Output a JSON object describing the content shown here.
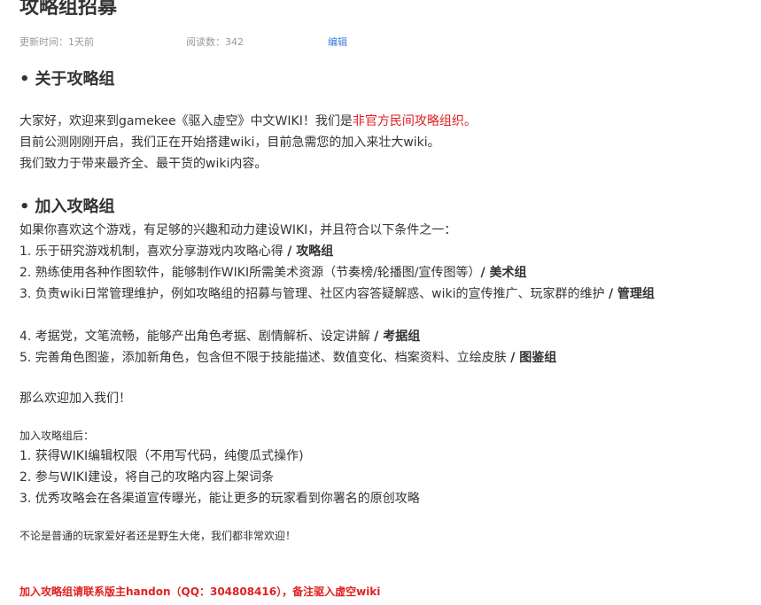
{
  "article": {
    "title": "攻略组招募",
    "meta": {
      "updated": "更新时间：1天前",
      "reads": "阅读数：342",
      "edit": "编辑"
    }
  },
  "sections": {
    "about": {
      "heading": "关于攻略组",
      "line1_part1": "大家好，欢迎来到gamekee《驱入虚空》中文WIKI！",
      "line1_part2": "我们是",
      "line1_red": "非官方民间攻略组织。",
      "line2": "目前公测刚刚开启，我们正在开始搭建wiki，目前急需您的加入来壮大wiki。",
      "line3": "我们致力于带来最齐全、最干货的wiki内容。"
    },
    "join": {
      "heading": "加入攻略组",
      "intro": "如果你喜欢这个游戏，有足够的兴趣和动力建设WIKI，并且符合以下条件之一：",
      "conditions": [
        {
          "text": "1. 乐于研究游戏机制，喜欢分享游戏内攻略心得 ",
          "group": "/ 攻略组"
        },
        {
          "text": "2. 熟练使用各种作图软件，能够制作WIKI所需美术资源（节奏榜/轮播图/宣传图等）",
          "group": "/ 美术组"
        },
        {
          "text": "3. 负责wiki日常管理维护，例如攻略组的招募与管理、社区内容答疑解惑、wiki的宣传推广、玩家群的维护 ",
          "group": "/ 管理组"
        },
        {
          "text": "4. 考据党，文笔流畅，能够产出角色考据、剧情解析、设定讲解 ",
          "group": "/ 考据组"
        },
        {
          "text": "5. 完善角色图鉴，添加新角色，包含但不限于技能描述、数值变化、档案资料、立绘皮肤 ",
          "group": "/ 图鉴组"
        }
      ],
      "welcome": "那么欢迎加入我们！"
    },
    "benefits": {
      "heading": "加入攻略组后：",
      "items": [
        "1. 获得WIKI编辑权限（不用写代码，纯傻瓜式操作)",
        "2. 参与WIKI建设，将自己的攻略内容上架词条",
        "3. 优秀攻略会在各渠道宣传曝光，能让更多的玩家看到你署名的原创攻略"
      ]
    },
    "closing": "不论是普通的玩家爱好者还是野生大佬，我们都非常欢迎！",
    "contact": "加入攻略组请联系版主handon（QQ：304808416），备注驱入虚空wiki"
  }
}
